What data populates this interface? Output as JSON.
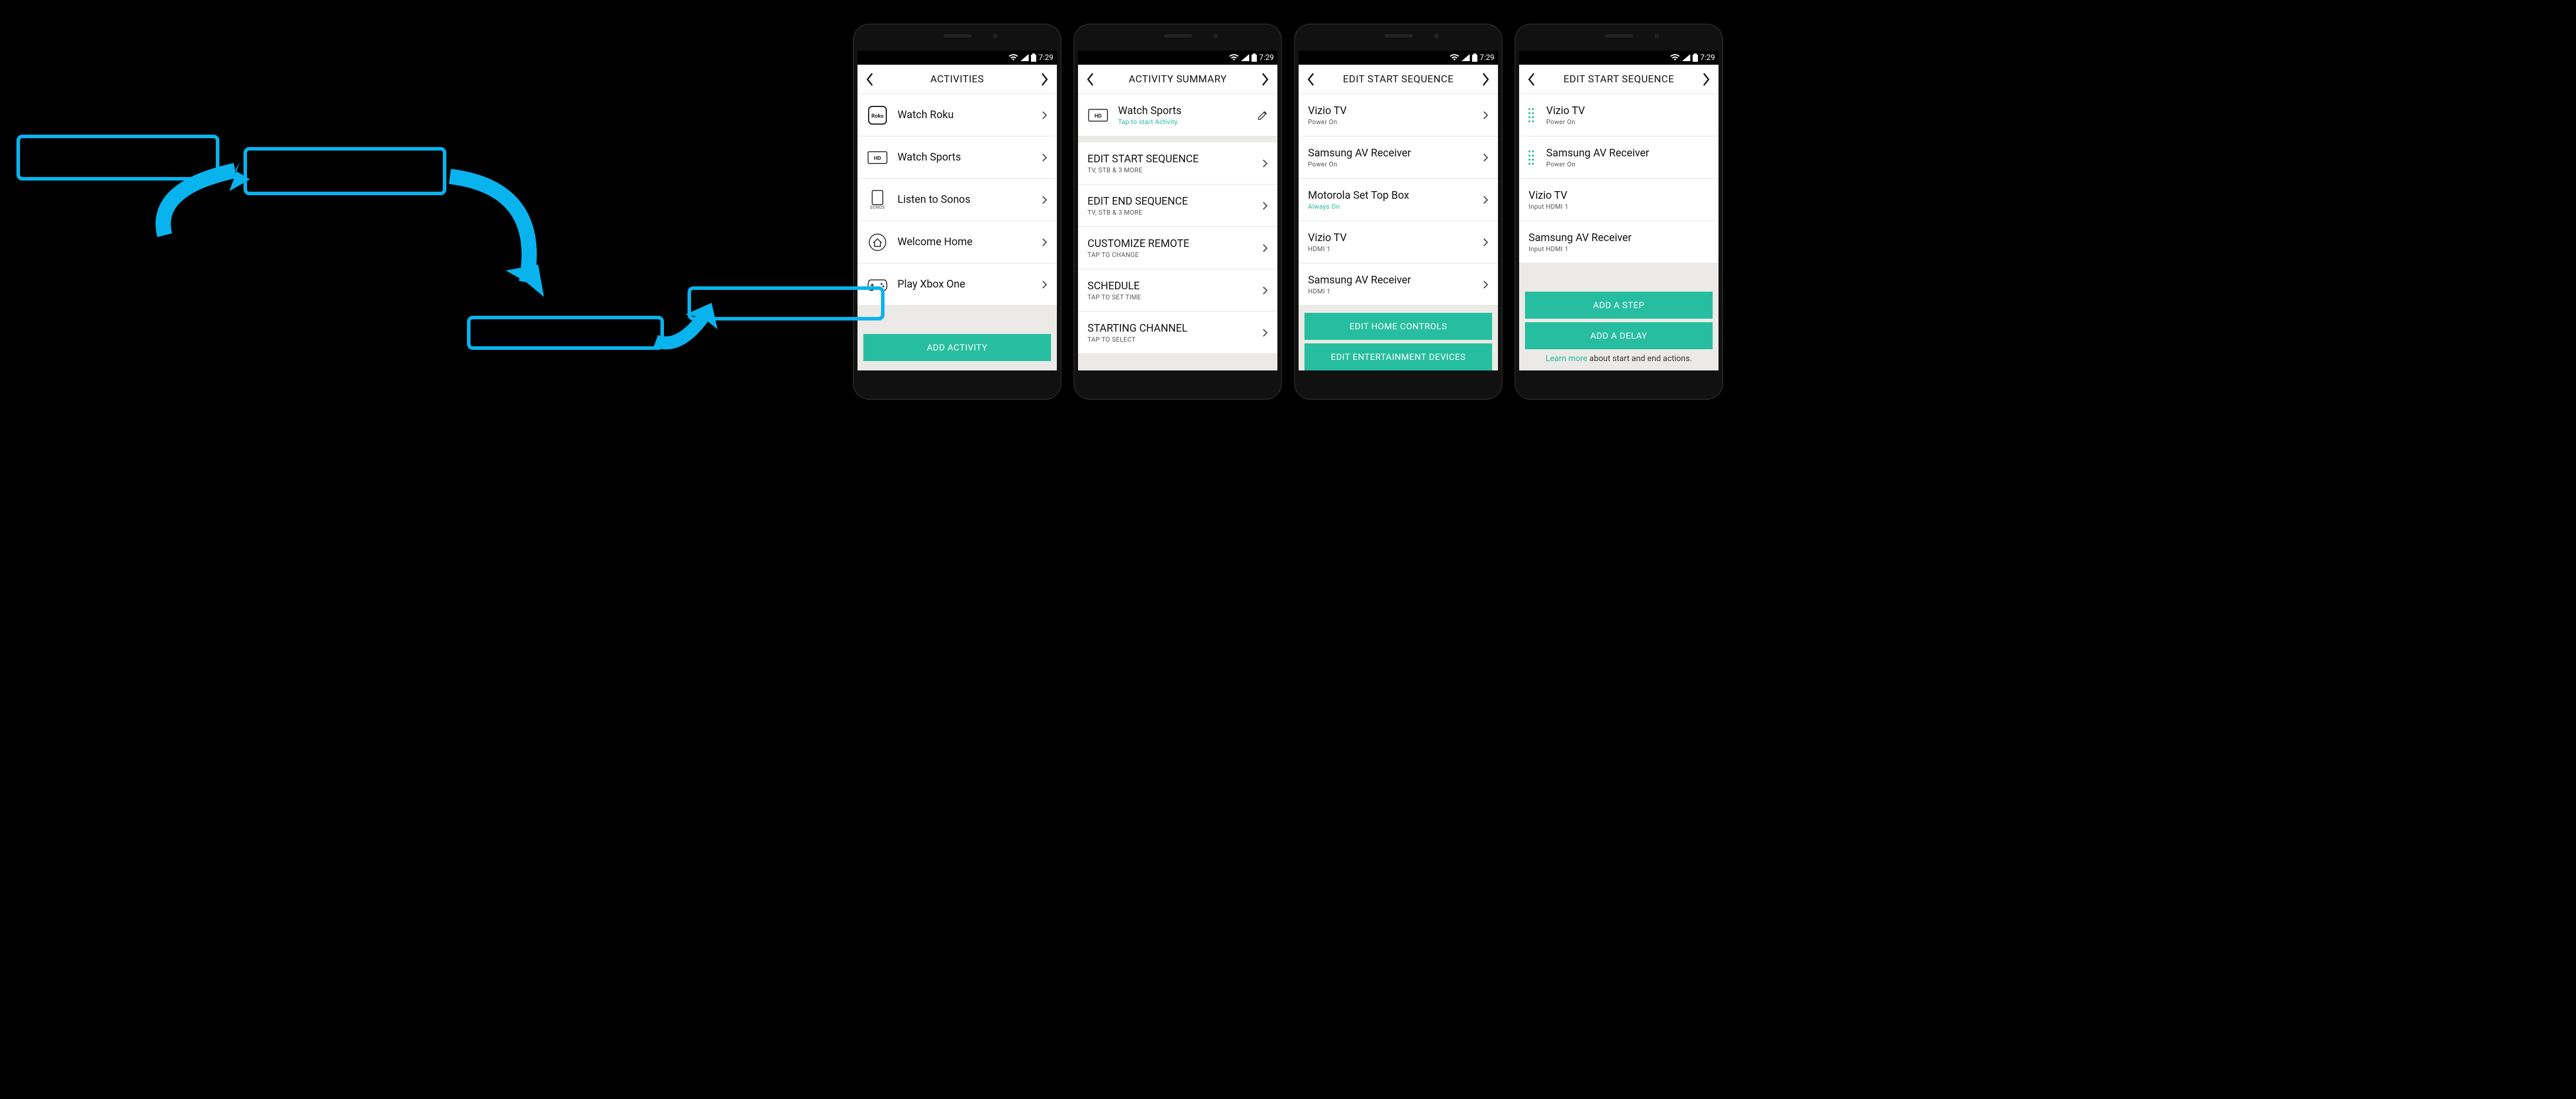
{
  "status": {
    "time": "7:29"
  },
  "colors": {
    "teal": "#27bda0",
    "highlight": "#08b3ee"
  },
  "screens": [
    {
      "title": "ACTIVITIES",
      "rows": [
        {
          "icon": "roku",
          "label": "Watch Roku"
        },
        {
          "icon": "hd",
          "label": "Watch Sports"
        },
        {
          "icon": "sonos",
          "label": "Listen to Sonos"
        },
        {
          "icon": "home",
          "label": "Welcome Home"
        },
        {
          "icon": "game",
          "label": "Play Xbox One"
        }
      ],
      "footer_button": "ADD ACTIVITY"
    },
    {
      "title": "ACTIVITY SUMMARY",
      "header_row": {
        "icon": "hd",
        "label": "Watch Sports",
        "sub": "Tap to start Activity"
      },
      "rows": [
        {
          "label": "EDIT START SEQUENCE",
          "sub": "TV, STB & 3 MORE"
        },
        {
          "label": "EDIT END SEQUENCE",
          "sub": "TV, STB & 3 MORE"
        },
        {
          "label": "CUSTOMIZE REMOTE",
          "sub": "TAP TO CHANGE"
        },
        {
          "label": "SCHEDULE",
          "sub": "TAP TO SET TIME"
        },
        {
          "label": "STARTING CHANNEL",
          "sub": "TAP TO SELECT"
        }
      ]
    },
    {
      "title": "EDIT START SEQUENCE",
      "rows": [
        {
          "label": "Vizio TV",
          "sub": "Power On"
        },
        {
          "label": "Samsung AV Receiver",
          "sub": "Power On"
        },
        {
          "label": "Motorola Set Top Box",
          "sub": "Always On",
          "sub_teal": true
        },
        {
          "label": "Vizio TV",
          "sub": "HDMI 1"
        },
        {
          "label": "Samsung AV Receiver",
          "sub": "HDMI 1"
        }
      ],
      "buttons": [
        "EDIT HOME CONTROLS",
        "EDIT ENTERTAINMENT DEVICES"
      ]
    },
    {
      "title": "EDIT START SEQUENCE",
      "rows": [
        {
          "drag": true,
          "label": "Vizio TV",
          "sub": "Power On"
        },
        {
          "drag": true,
          "label": "Samsung AV Receiver",
          "sub": "Power On"
        },
        {
          "label": "Vizio TV",
          "sub": "Input HDMI 1"
        },
        {
          "label": "Samsung AV Receiver",
          "sub": "Input HDMI 1"
        }
      ],
      "buttons": [
        "ADD A STEP",
        "ADD A DELAY"
      ],
      "learn_prefix": "Learn more",
      "learn_rest": " about start and end actions."
    }
  ]
}
